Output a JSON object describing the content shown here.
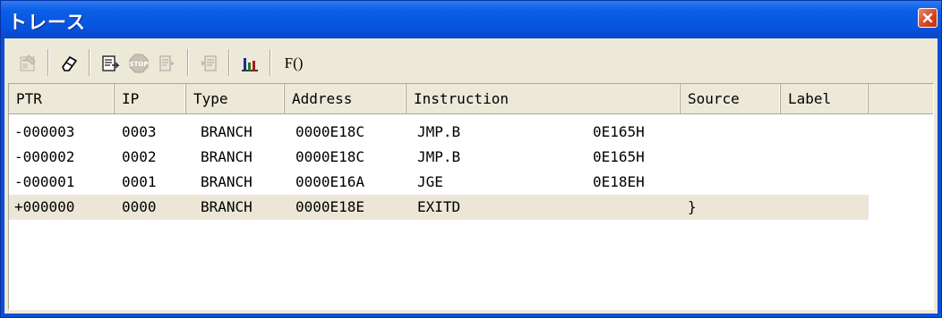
{
  "window": {
    "title": "トレース",
    "title_color": "#ffffff",
    "titlebar_color": "#0a56e0",
    "close_button_color": "#d24524"
  },
  "toolbar": {
    "buttons": [
      {
        "name": "properties-icon",
        "enabled": false
      },
      {
        "name": "eraser-icon",
        "enabled": true
      },
      {
        "name": "trace-window-icon",
        "enabled": true
      },
      {
        "name": "stop-icon",
        "enabled": false
      },
      {
        "name": "restart-icon",
        "enabled": false
      },
      {
        "name": "jump-icon",
        "enabled": false
      },
      {
        "name": "bar-chart-icon",
        "enabled": true
      }
    ],
    "function_button_label": "F()"
  },
  "columns": [
    {
      "key": "ptr",
      "label": "PTR"
    },
    {
      "key": "ip",
      "label": "IP"
    },
    {
      "key": "type",
      "label": "Type"
    },
    {
      "key": "address",
      "label": "Address"
    },
    {
      "key": "instruction",
      "label": "Instruction"
    },
    {
      "key": "source",
      "label": "Source"
    },
    {
      "key": "label",
      "label": "Label"
    }
  ],
  "rows": [
    {
      "ptr": "-000003",
      "ip": "0003",
      "type": "BRANCH",
      "address": "0000E18C",
      "mnemonic": "JMP.B",
      "operand": "0E165H",
      "source": "",
      "label": ""
    },
    {
      "ptr": "-000002",
      "ip": "0002",
      "type": "BRANCH",
      "address": "0000E18C",
      "mnemonic": "JMP.B",
      "operand": "0E165H",
      "source": "",
      "label": ""
    },
    {
      "ptr": "-000001",
      "ip": "0001",
      "type": "BRANCH",
      "address": "0000E16A",
      "mnemonic": "JGE",
      "operand": "0E18EH",
      "source": "",
      "label": ""
    },
    {
      "ptr": "+000000",
      "ip": "0000",
      "type": "BRANCH",
      "address": "0000E18E",
      "mnemonic": "EXITD",
      "operand": "",
      "source": "}",
      "label": ""
    }
  ],
  "selected_row": 3,
  "selection_color": "#ebe6d6"
}
